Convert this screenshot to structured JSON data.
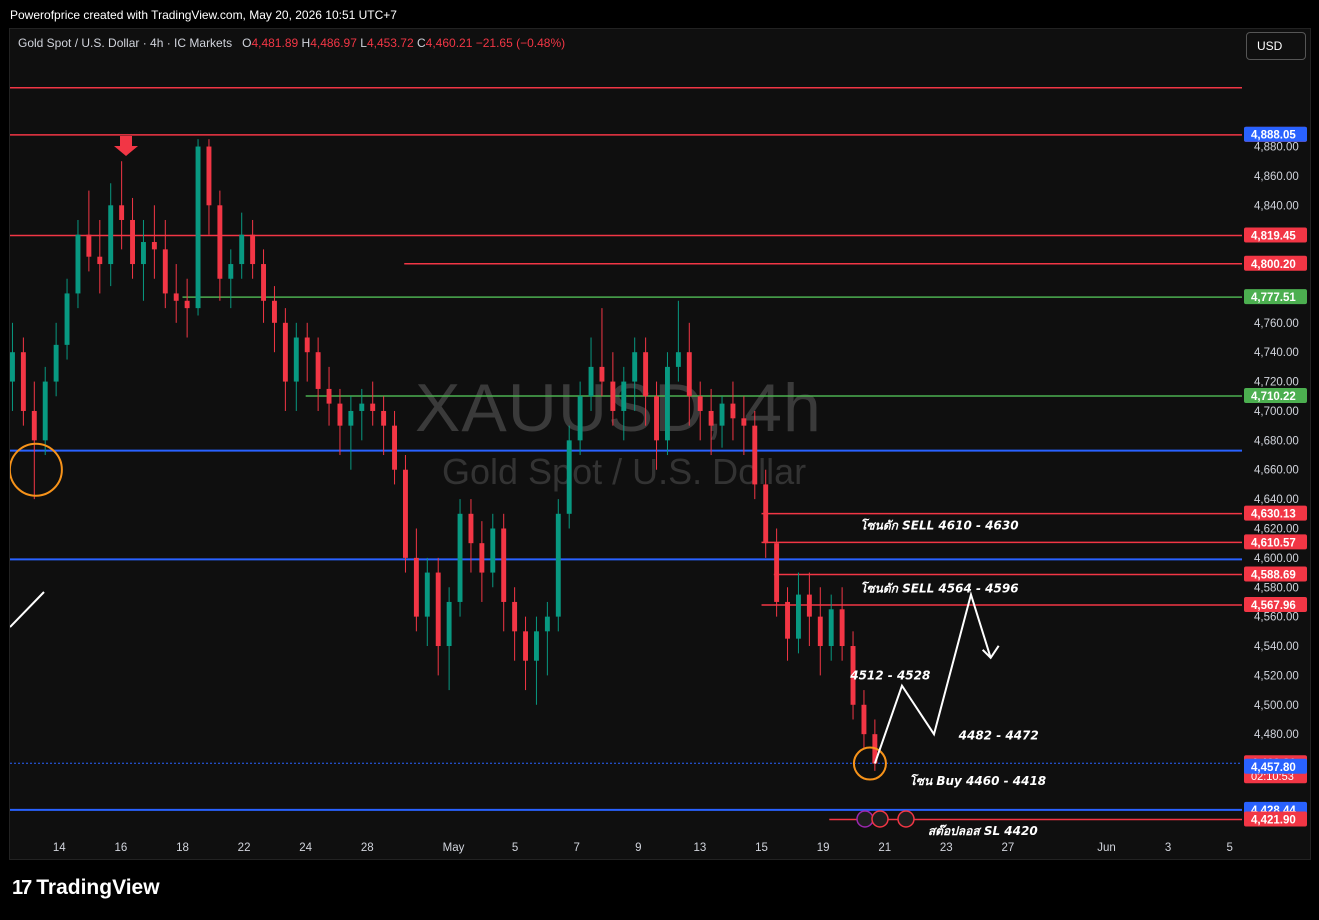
{
  "caption": "Powerofprice created with TradingView.com, May 20, 2026 10:51 UTC+7",
  "header": {
    "symbol": "Gold Spot / U.S. Dollar · 4h · IC Markets",
    "o_label": "O",
    "o": "4,481.89",
    "h_label": "H",
    "h": "4,486.97",
    "l_label": "L",
    "l": "4,453.72",
    "c_label": "C",
    "c": "4,460.21",
    "change": "−21.65 (−0.48%)"
  },
  "currency_button": "USD",
  "watermark": {
    "line1": "XAUUSD, 4h",
    "line2": "Gold Spot / U.S. Dollar"
  },
  "footer": {
    "brand": "TradingView"
  },
  "colors": {
    "background": "#0f0f0f",
    "up": "#089981",
    "down": "#f23645",
    "red_line": "#f23645",
    "blue_line": "#2962ff",
    "green_line": "#4caf50",
    "text": "#d1d4dc"
  },
  "chart_data": {
    "type": "candlestick",
    "symbol": "XAUUSD",
    "timeframe": "4h",
    "y_range": [
      4410,
      4960
    ],
    "y_ticks": [
      4480,
      4500,
      4520,
      4540,
      4560,
      4580,
      4600,
      4620,
      4640,
      4660,
      4680,
      4700,
      4720,
      4740,
      4760,
      4840,
      4860,
      4880
    ],
    "y_tick_labels": [
      "4,480.00",
      "4,500.00",
      "4,520.00",
      "4,540.00",
      "4,560.00",
      "4,580.00",
      "4,600.00",
      "4,620.00",
      "4,640.00",
      "4,660.00",
      "4,680.00",
      "4,700.00",
      "4,720.00",
      "4,740.00",
      "4,760.00",
      "4,840.00",
      "4,860.00",
      "4,880.00"
    ],
    "x_labels": [
      "14",
      "16",
      "18",
      "22",
      "24",
      "28",
      "May",
      "5",
      "7",
      "9",
      "13",
      "15",
      "19",
      "21",
      "23",
      "27",
      "Jun",
      "3",
      "5"
    ],
    "horizontal_levels": [
      {
        "price": 4920,
        "label": "",
        "color": "red",
        "from": 0
      },
      {
        "price": 4887.92,
        "label": "4,887.92",
        "color": "red",
        "from": 0
      },
      {
        "price": 4819.45,
        "label": "4,819.45",
        "color": "red",
        "from": 0
      },
      {
        "price": 4800.2,
        "label": "4,800.20",
        "color": "red",
        "from": 0.32
      },
      {
        "price": 4777.51,
        "label": "4,777.51",
        "color": "green",
        "from": 0.14
      },
      {
        "price": 4710.22,
        "label": "4,710.22",
        "color": "green",
        "from": 0.24
      },
      {
        "price": 4673,
        "label": "",
        "color": "blue",
        "from": 0
      },
      {
        "price": 4630.13,
        "label": "4,630.13",
        "color": "red",
        "from": 0.61
      },
      {
        "price": 4610.57,
        "label": "4,610.57",
        "color": "red",
        "from": 0.61
      },
      {
        "price": 4599,
        "label": "",
        "color": "blue",
        "from": 0
      },
      {
        "price": 4588.69,
        "label": "4,588.69",
        "color": "red",
        "from": 0.62
      },
      {
        "price": 4567.96,
        "label": "4,567.96",
        "color": "red",
        "from": 0.61
      },
      {
        "price": 4428.44,
        "label": "4,428.44",
        "color": "blue",
        "from": 0
      },
      {
        "price": 4421.9,
        "label": "4,421.90",
        "color": "red",
        "from": 0.665
      }
    ],
    "price_tags": [
      {
        "price": 4888.05,
        "label": "4,888.05",
        "color": "blue"
      },
      {
        "price": 4460.21,
        "label": "4,460.21",
        "color": "red",
        "sub": "02:10:53"
      },
      {
        "price": 4457.8,
        "label": "4,457.80",
        "color": "blue"
      }
    ],
    "annotations": [
      {
        "text": "โซนดัก SELL 4610 - 4630",
        "price": 4622,
        "x": 0.69
      },
      {
        "text": "โซนดัก SELL 4564 - 4596",
        "price": 4579,
        "x": 0.69
      },
      {
        "text": "4512 - 4528",
        "price": 4520,
        "x": 0.682
      },
      {
        "text": "4482 - 4472",
        "price": 4479,
        "x": 0.77
      },
      {
        "text": "โซน Buy 4460 - 4418",
        "price": 4448,
        "x": 0.73
      },
      {
        "text": "สต๊อปลอส SL 4420",
        "price": 4414,
        "x": 0.745
      }
    ],
    "projection_path": [
      [
        0.702,
        4460
      ],
      [
        0.724,
        4513
      ],
      [
        0.75,
        4480
      ],
      [
        0.78,
        4575
      ],
      [
        0.796,
        4532
      ]
    ],
    "circles": [
      [
        0.021,
        4660
      ],
      [
        0.698,
        4460
      ]
    ],
    "candles": [
      [
        4720,
        4760,
        4700,
        4740
      ],
      [
        4740,
        4750,
        4690,
        4700
      ],
      [
        4700,
        4720,
        4640,
        4680
      ],
      [
        4680,
        4730,
        4670,
        4720
      ],
      [
        4720,
        4760,
        4710,
        4745
      ],
      [
        4745,
        4790,
        4735,
        4780
      ],
      [
        4780,
        4830,
        4770,
        4820
      ],
      [
        4820,
        4850,
        4795,
        4805
      ],
      [
        4805,
        4830,
        4780,
        4800
      ],
      [
        4800,
        4855,
        4785,
        4840
      ],
      [
        4840,
        4870,
        4810,
        4830
      ],
      [
        4830,
        4845,
        4790,
        4800
      ],
      [
        4800,
        4830,
        4775,
        4815
      ],
      [
        4815,
        4840,
        4790,
        4810
      ],
      [
        4810,
        4830,
        4770,
        4780
      ],
      [
        4780,
        4800,
        4760,
        4775
      ],
      [
        4775,
        4790,
        4750,
        4770
      ],
      [
        4770,
        4885,
        4765,
        4880
      ],
      [
        4880,
        4885,
        4820,
        4840
      ],
      [
        4840,
        4850,
        4775,
        4790
      ],
      [
        4790,
        4810,
        4770,
        4800
      ],
      [
        4800,
        4835,
        4790,
        4820
      ],
      [
        4820,
        4830,
        4790,
        4800
      ],
      [
        4800,
        4810,
        4760,
        4775
      ],
      [
        4775,
        4785,
        4740,
        4760
      ],
      [
        4760,
        4770,
        4700,
        4720
      ],
      [
        4720,
        4760,
        4700,
        4750
      ],
      [
        4750,
        4760,
        4720,
        4740
      ],
      [
        4740,
        4750,
        4700,
        4715
      ],
      [
        4715,
        4730,
        4690,
        4705
      ],
      [
        4705,
        4715,
        4670,
        4690
      ],
      [
        4690,
        4710,
        4660,
        4700
      ],
      [
        4700,
        4715,
        4680,
        4705
      ],
      [
        4705,
        4720,
        4690,
        4700
      ],
      [
        4700,
        4710,
        4670,
        4690
      ],
      [
        4690,
        4700,
        4650,
        4660
      ],
      [
        4660,
        4670,
        4590,
        4600
      ],
      [
        4600,
        4620,
        4550,
        4560
      ],
      [
        4560,
        4600,
        4540,
        4590
      ],
      [
        4590,
        4600,
        4520,
        4540
      ],
      [
        4540,
        4580,
        4510,
        4570
      ],
      [
        4570,
        4640,
        4560,
        4630
      ],
      [
        4630,
        4640,
        4590,
        4610
      ],
      [
        4610,
        4625,
        4570,
        4590
      ],
      [
        4590,
        4630,
        4580,
        4620
      ],
      [
        4620,
        4630,
        4550,
        4570
      ],
      [
        4570,
        4580,
        4530,
        4550
      ],
      [
        4550,
        4560,
        4510,
        4530
      ],
      [
        4530,
        4560,
        4500,
        4550
      ],
      [
        4550,
        4570,
        4520,
        4560
      ],
      [
        4560,
        4640,
        4550,
        4630
      ],
      [
        4630,
        4690,
        4620,
        4680
      ],
      [
        4680,
        4720,
        4670,
        4710
      ],
      [
        4710,
        4750,
        4700,
        4730
      ],
      [
        4730,
        4770,
        4710,
        4720
      ],
      [
        4720,
        4740,
        4690,
        4700
      ],
      [
        4700,
        4730,
        4680,
        4720
      ],
      [
        4720,
        4750,
        4700,
        4740
      ],
      [
        4740,
        4750,
        4690,
        4710
      ],
      [
        4710,
        4720,
        4660,
        4680
      ],
      [
        4680,
        4740,
        4670,
        4730
      ],
      [
        4730,
        4775,
        4720,
        4740
      ],
      [
        4740,
        4760,
        4690,
        4710
      ],
      [
        4710,
        4720,
        4680,
        4700
      ],
      [
        4700,
        4715,
        4670,
        4690
      ],
      [
        4690,
        4710,
        4675,
        4705
      ],
      [
        4705,
        4720,
        4680,
        4695
      ],
      [
        4695,
        4710,
        4670,
        4690
      ],
      [
        4690,
        4700,
        4640,
        4650
      ],
      [
        4650,
        4660,
        4600,
        4610
      ],
      [
        4610,
        4620,
        4560,
        4570
      ],
      [
        4570,
        4580,
        4530,
        4545
      ],
      [
        4545,
        4590,
        4535,
        4575
      ],
      [
        4575,
        4590,
        4540,
        4560
      ],
      [
        4560,
        4580,
        4520,
        4540
      ],
      [
        4540,
        4575,
        4530,
        4565
      ],
      [
        4565,
        4580,
        4530,
        4540
      ],
      [
        4540,
        4550,
        4490,
        4500
      ],
      [
        4500,
        4510,
        4470,
        4480
      ],
      [
        4480,
        4490,
        4455,
        4460
      ]
    ]
  }
}
